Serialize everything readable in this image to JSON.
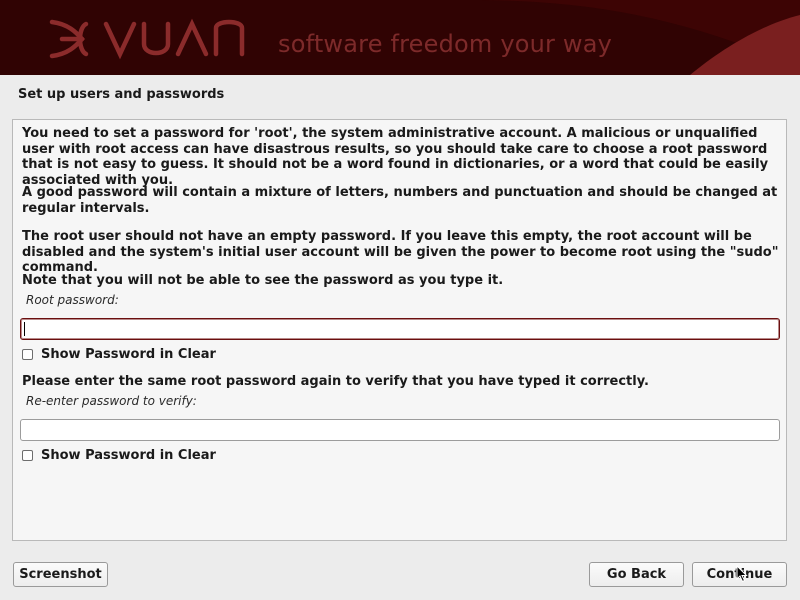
{
  "header": {
    "logo_text": "DEVUAN",
    "tagline": "software freedom your way"
  },
  "step": {
    "title": "Set up users and passwords"
  },
  "content": {
    "para1": "You need to set a password for 'root', the system administrative account. A malicious or unqualified user with root access can have disastrous results, so you should take care to choose a root password that is not easy to guess. It should not be a word found in dictionaries, or a word that could be easily associated with you.",
    "para2": "A good password will contain a mixture of letters, numbers and punctuation and should be changed at regular intervals.",
    "para3": "The root user should not have an empty password. If you leave this empty, the root account will be disabled and the system's initial user account will be given the power to become root using the \"sudo\" command.",
    "para4": "Note that you will not be able to see the password as you type it.",
    "root_password_label": "Root password:",
    "root_password_value": "",
    "show_password_label_1": "Show Password in Clear",
    "show_password_checked_1": false,
    "verify_instruction": "Please enter the same root password again to verify that you have typed it correctly.",
    "reenter_label": "Re-enter password to verify:",
    "reenter_value": "",
    "show_password_label_2": "Show Password in Clear",
    "show_password_checked_2": false
  },
  "buttons": {
    "screenshot": "Screenshot",
    "go_back": "Go Back",
    "continue": "Continue"
  },
  "colors": {
    "banner_dark": "#3d0404",
    "banner_accent": "#7a1f1f",
    "tagline": "#7d2a2a",
    "focus_border": "#6b0f0f"
  },
  "icons": {
    "logo": "devuan-logo-icon",
    "cursor": "mouse-pointer-icon"
  }
}
